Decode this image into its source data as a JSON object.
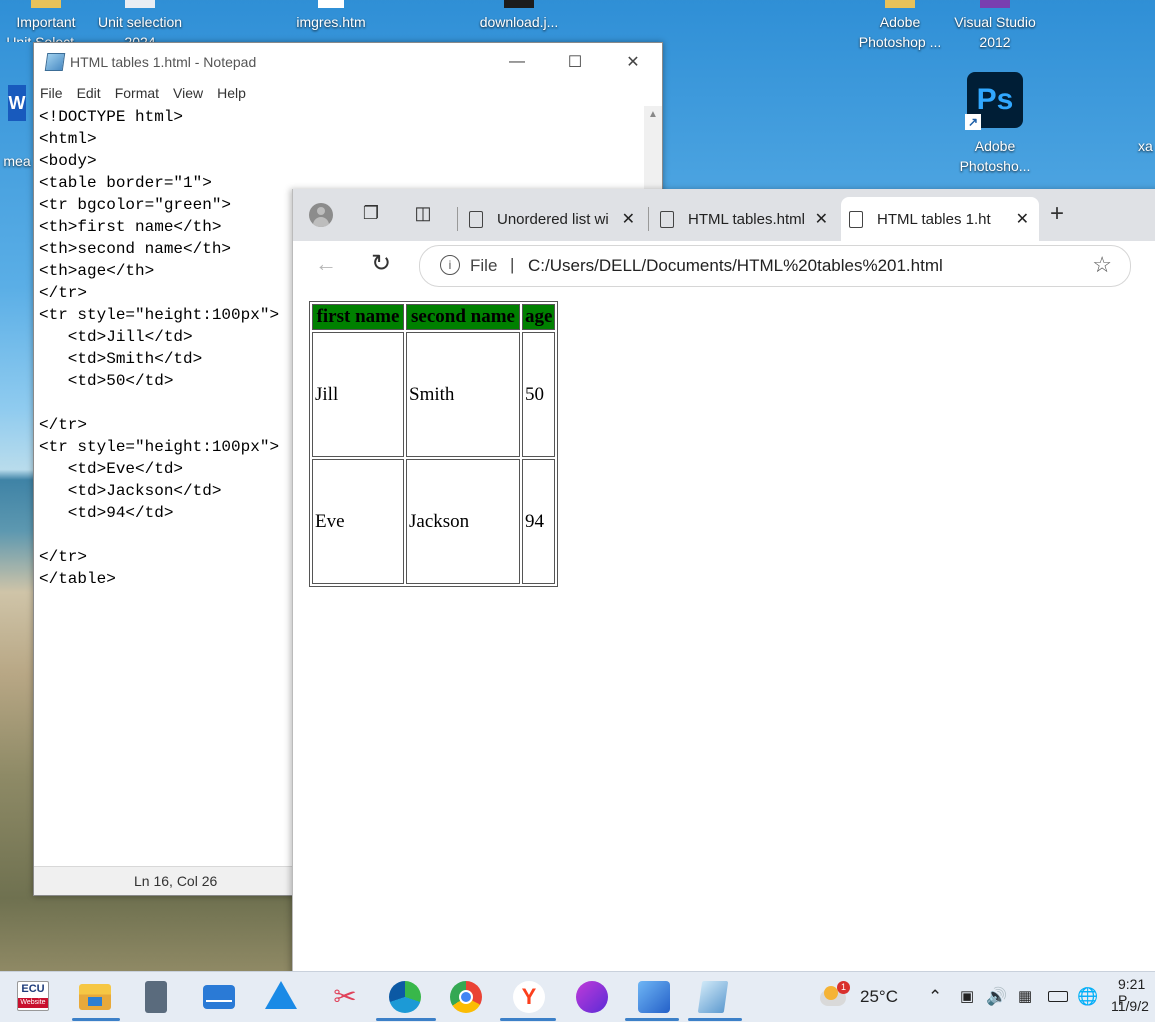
{
  "desktop": {
    "icons": [
      {
        "line1": "Important",
        "line2": "Unit Select..."
      },
      {
        "line1": "Unit selection",
        "line2": "2024"
      },
      {
        "line1": "imgres.htm"
      },
      {
        "line1": "download.j..."
      },
      {
        "line1": "Adobe",
        "line2": "Photoshop ..."
      },
      {
        "line1": "Visual Studio",
        "line2": "2012"
      },
      {
        "line1": "Adobe",
        "line2": "Photosho..."
      },
      {
        "line1": "mea"
      },
      {
        "line1": "xa"
      }
    ]
  },
  "notepad": {
    "title": "HTML tables 1.html - Notepad",
    "menu": [
      "File",
      "Edit",
      "Format",
      "View",
      "Help"
    ],
    "content": "<!DOCTYPE html>\n<html>\n<body>\n<table border=\"1\">\n<tr bgcolor=\"green\">\n<th>first name</th>\n<th>second name</th>\n<th>age</th>\n</tr>\n<tr style=\"height:100px\">\n   <td>Jill</td>\n   <td>Smith</td>\n   <td>50</td>\n\n</tr>\n<tr style=\"height:100px\">\n   <td>Eve</td>\n   <td>Jackson</td>\n   <td>94</td>\n\n</tr>\n</table>",
    "status": "Ln 16, Col 26"
  },
  "browser": {
    "tabs": [
      {
        "label": "Unordered list wi"
      },
      {
        "label": "HTML tables.html"
      },
      {
        "label": "HTML tables 1.ht"
      }
    ],
    "address_prefix": "File",
    "address": "C:/Users/DELL/Documents/HTML%20tables%201.html",
    "table": {
      "header_bg": "#008000",
      "headers": [
        "first name",
        "second name",
        "age"
      ],
      "rows": [
        [
          "Jill",
          "Smith",
          "50"
        ],
        [
          "Eve",
          "Jackson",
          "94"
        ]
      ]
    }
  },
  "taskbar": {
    "apps": [
      "ECU Website",
      "File Explorer",
      "Calculator",
      "Mail",
      "Azure",
      "Snipping Tool",
      "Microsoft Edge",
      "Google Chrome",
      "Yandex",
      "Copilot",
      "Photos",
      "Notepad"
    ],
    "weather_badge": "1",
    "temperature": "25°C",
    "time": "9:21 P",
    "date": "11/9/2",
    "ecu_text": "ECU",
    "ecu_sub": "Website"
  }
}
